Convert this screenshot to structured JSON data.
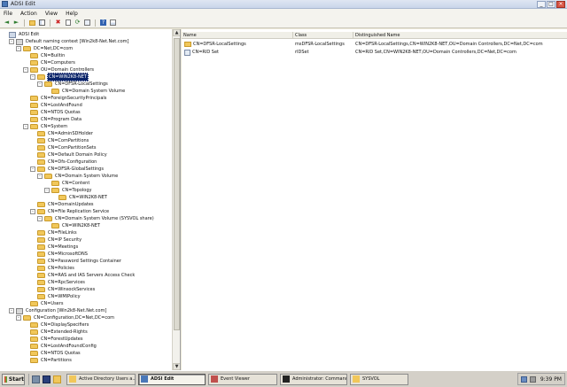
{
  "window": {
    "title": "ADSI Edit"
  },
  "menu": [
    "File",
    "Action",
    "View",
    "Help"
  ],
  "toolbar": [
    "back-icon",
    "forward-icon",
    "up-icon",
    "show-tree-icon",
    "delete-icon",
    "properties-icon",
    "refresh-icon",
    "export-icon",
    "help-icon",
    "show-hide-icon"
  ],
  "tree": [
    {
      "label": "ADSI Edit",
      "depth": 0,
      "exp": "",
      "icon": "root"
    },
    {
      "label": "Default naming context [Win2k8-Net.Net.com]",
      "depth": 1,
      "exp": "-",
      "icon": "ctx"
    },
    {
      "label": "DC=Net,DC=com",
      "depth": 2,
      "exp": "-",
      "icon": "folder"
    },
    {
      "label": "CN=Builtin",
      "depth": 3,
      "exp": "",
      "icon": "folder"
    },
    {
      "label": "CN=Computers",
      "depth": 3,
      "exp": "",
      "icon": "folder"
    },
    {
      "label": "OU=Domain Controllers",
      "depth": 3,
      "exp": "-",
      "icon": "folder"
    },
    {
      "label": "CN=WIN2K8-NET",
      "depth": 4,
      "exp": "-",
      "icon": "folder",
      "selected": true
    },
    {
      "label": "CN=DFSR-LocalSettings",
      "depth": 5,
      "exp": "-",
      "icon": "folder"
    },
    {
      "label": "CN=Domain System Volume",
      "depth": 6,
      "exp": "",
      "icon": "folder"
    },
    {
      "label": "CN=ForeignSecurityPrincipals",
      "depth": 3,
      "exp": "",
      "icon": "folder"
    },
    {
      "label": "CN=LostAndFound",
      "depth": 3,
      "exp": "",
      "icon": "folder"
    },
    {
      "label": "CN=NTDS Quotas",
      "depth": 3,
      "exp": "",
      "icon": "folder"
    },
    {
      "label": "CN=Program Data",
      "depth": 3,
      "exp": "",
      "icon": "folder"
    },
    {
      "label": "CN=System",
      "depth": 3,
      "exp": "-",
      "icon": "folder"
    },
    {
      "label": "CN=AdminSDHolder",
      "depth": 4,
      "exp": "",
      "icon": "folder"
    },
    {
      "label": "CN=ComPartitions",
      "depth": 4,
      "exp": "",
      "icon": "folder"
    },
    {
      "label": "CN=ComPartitionSets",
      "depth": 4,
      "exp": "",
      "icon": "folder"
    },
    {
      "label": "CN=Default Domain Policy",
      "depth": 4,
      "exp": "",
      "icon": "folder"
    },
    {
      "label": "CN=Dfs-Configuration",
      "depth": 4,
      "exp": "",
      "icon": "folder"
    },
    {
      "label": "CN=DFSR-GlobalSettings",
      "depth": 4,
      "exp": "-",
      "icon": "folder"
    },
    {
      "label": "CN=Domain System Volume",
      "depth": 5,
      "exp": "-",
      "icon": "folder"
    },
    {
      "label": "CN=Content",
      "depth": 6,
      "exp": "",
      "icon": "folder"
    },
    {
      "label": "CN=Topology",
      "depth": 6,
      "exp": "-",
      "icon": "folder"
    },
    {
      "label": "CN=WIN2K8-NET",
      "depth": 7,
      "exp": "",
      "icon": "folder"
    },
    {
      "label": "CN=DomainUpdates",
      "depth": 4,
      "exp": "",
      "icon": "folder"
    },
    {
      "label": "CN=File Replication Service",
      "depth": 4,
      "exp": "-",
      "icon": "folder"
    },
    {
      "label": "CN=Domain System Volume (SYSVOL share)",
      "depth": 5,
      "exp": "-",
      "icon": "folder"
    },
    {
      "label": "CN=WIN2K8-NET",
      "depth": 6,
      "exp": "",
      "icon": "folder"
    },
    {
      "label": "CN=FileLinks",
      "depth": 4,
      "exp": "",
      "icon": "folder"
    },
    {
      "label": "CN=IP Security",
      "depth": 4,
      "exp": "",
      "icon": "folder"
    },
    {
      "label": "CN=Meetings",
      "depth": 4,
      "exp": "",
      "icon": "folder"
    },
    {
      "label": "CN=MicrosoftDNS",
      "depth": 4,
      "exp": "",
      "icon": "folder"
    },
    {
      "label": "CN=Password Settings Container",
      "depth": 4,
      "exp": "",
      "icon": "folder"
    },
    {
      "label": "CN=Policies",
      "depth": 4,
      "exp": "",
      "icon": "folder"
    },
    {
      "label": "CN=RAS and IAS Servers Access Check",
      "depth": 4,
      "exp": "",
      "icon": "folder"
    },
    {
      "label": "CN=RpcServices",
      "depth": 4,
      "exp": "",
      "icon": "folder"
    },
    {
      "label": "CN=WinsockServices",
      "depth": 4,
      "exp": "",
      "icon": "folder"
    },
    {
      "label": "CN=WMIPolicy",
      "depth": 4,
      "exp": "",
      "icon": "folder"
    },
    {
      "label": "CN=Users",
      "depth": 3,
      "exp": "",
      "icon": "folder"
    },
    {
      "label": "Configuration [Win2k8-Net.Net.com]",
      "depth": 1,
      "exp": "-",
      "icon": "ctx"
    },
    {
      "label": "CN=Configuration,DC=Net,DC=com",
      "depth": 2,
      "exp": "-",
      "icon": "folder"
    },
    {
      "label": "CN=DisplaySpecifiers",
      "depth": 3,
      "exp": "",
      "icon": "folder"
    },
    {
      "label": "CN=Extended-Rights",
      "depth": 3,
      "exp": "",
      "icon": "folder"
    },
    {
      "label": "CN=ForestUpdates",
      "depth": 3,
      "exp": "",
      "icon": "folder"
    },
    {
      "label": "CN=LostAndFoundConfig",
      "depth": 3,
      "exp": "",
      "icon": "folder"
    },
    {
      "label": "CN=NTDS Quotas",
      "depth": 3,
      "exp": "",
      "icon": "folder"
    },
    {
      "label": "CN=Partitions",
      "depth": 3,
      "exp": "",
      "icon": "folder"
    }
  ],
  "list": {
    "columns": [
      "Name",
      "Class",
      "Distinguished Name"
    ],
    "rows": [
      {
        "icon": "folder",
        "name": "CN=DFSR-LocalSettings",
        "class": "msDFSR-LocalSettings",
        "dn": "CN=DFSR-LocalSettings,CN=WIN2K8-NET,OU=Domain Controllers,DC=Net,DC=com"
      },
      {
        "icon": "object",
        "name": "CN=RID Set",
        "class": "rIDSet",
        "dn": "CN=RID Set,CN=WIN2K8-NET,OU=Domain Controllers,DC=Net,DC=com"
      }
    ]
  },
  "taskbar": {
    "start": "Start",
    "tasks": [
      {
        "label": "Active Directory Users a...",
        "active": false
      },
      {
        "label": "ADSI Edit",
        "active": true
      },
      {
        "label": "Event Viewer",
        "active": false
      },
      {
        "label": "Administrator: Command...",
        "active": false
      },
      {
        "label": "SYSVOL",
        "active": false
      }
    ],
    "clock": "9:39 PM"
  }
}
